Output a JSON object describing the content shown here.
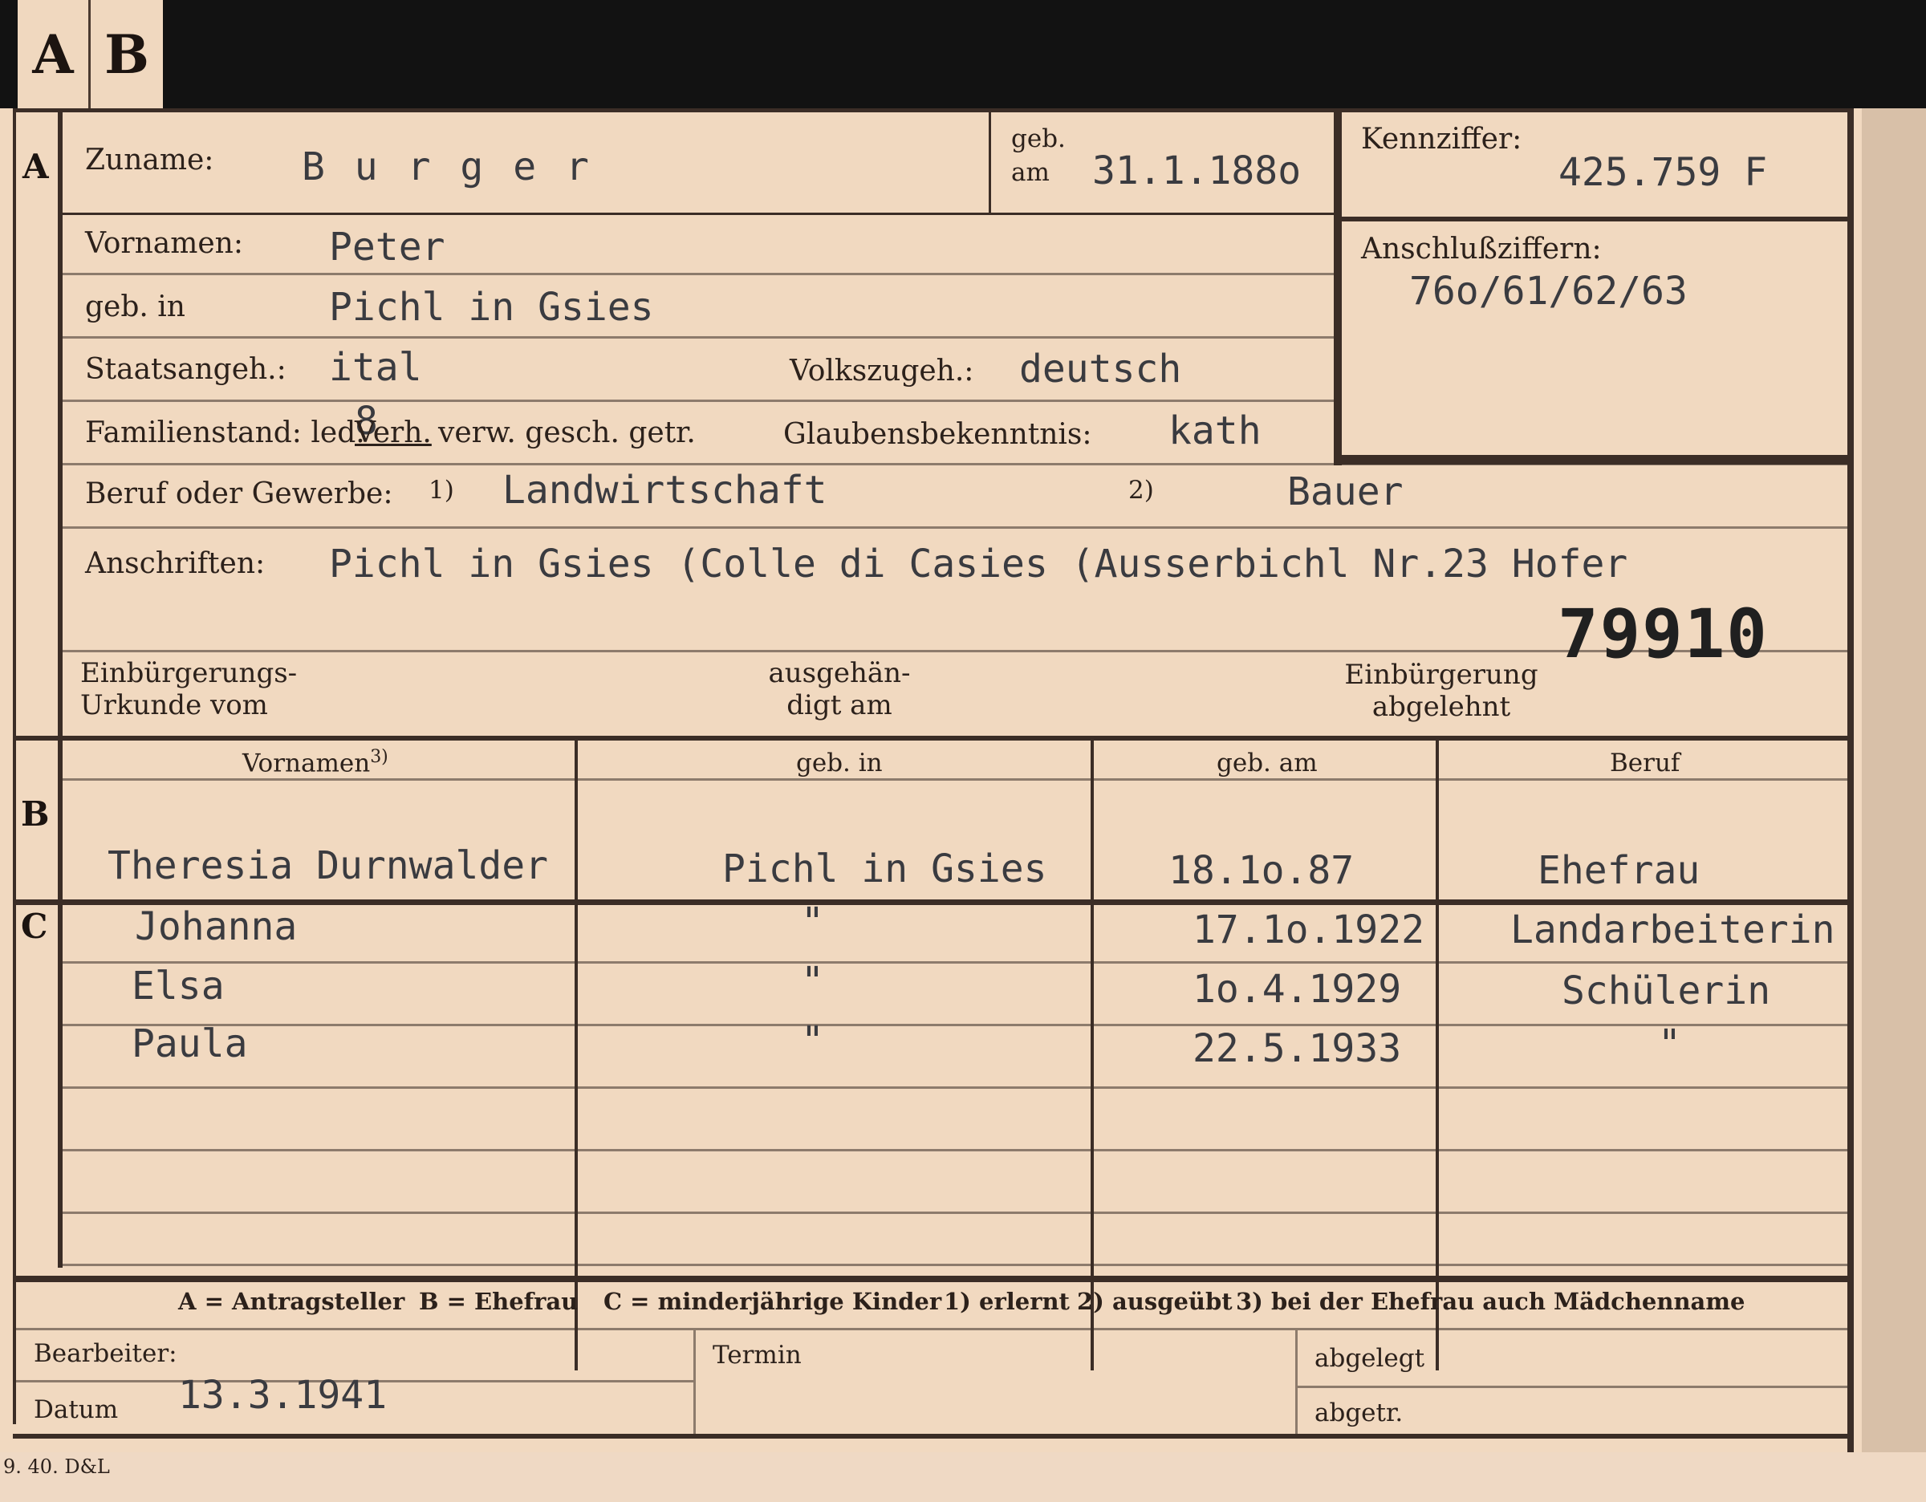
{
  "header_tabs": {
    "a": "A",
    "b": "B"
  },
  "sections": {
    "a": "A",
    "b": "B",
    "c": "C"
  },
  "labels": {
    "zuname": "Zuname:",
    "geb": "geb.",
    "am": "am",
    "kennziffer": "Kennziffer:",
    "vornamen": "Vornamen:",
    "anschlussziffern": "Anschlußziffern:",
    "geb_in": "geb. in",
    "staatsangeh": "Staatsangeh.:",
    "volkszugeh": "Volkszugeh.:",
    "familienstand": "Familienstand: led.",
    "familienstand_options": "verw. gesch. getr.",
    "verh": "Verh.",
    "glaubensbekenntnis": "Glaubensbekenntnis:",
    "beruf_oder_gewerbe": "Beruf oder Gewerbe:",
    "note1": "1)",
    "note2": "2)",
    "anschriften": "Anschriften:",
    "einbuergerung_urkunde": "Einbürgerungs-\nUrkunde vom",
    "ausgehaendigt": "ausgehän-\ndigt am",
    "einbuergerung_abgelehnt": "Einbürgerung\nabgelehnt",
    "bearbeiter": "Bearbeiter:",
    "datum": "Datum",
    "termin": "Termin",
    "abgelegt": "abgelegt",
    "abgetr": "abgetr."
  },
  "applicant": {
    "surname": "B u r g e r",
    "birth_date": "31.1.188o",
    "kennziffer": "425.759 F",
    "first_names": "Peter",
    "anschlussziffern": "76o/61/62/63",
    "birthplace": "Pichl in Gsies",
    "citizenship": "ital",
    "ethnicity": "deutsch",
    "status_mark": "8",
    "religion": "kath",
    "occupation_learned": "Landwirtschaft",
    "occupation_practiced": "Bauer",
    "address": "Pichl in Gsies (Colle di Casies (Ausserbichl Nr.23 Hofer",
    "stamp_number": "79910"
  },
  "family_table": {
    "headers": [
      "Vornamen",
      "geb. in",
      "geb. am",
      "Beruf"
    ],
    "header_note": "3)",
    "spouse": {
      "name": "Theresia Durnwalder",
      "birthplace": "Pichl in Gsies",
      "birth_date": "18.1o.87",
      "occupation": "Ehefrau"
    },
    "children": [
      {
        "name": "Johanna",
        "birthplace": "\"",
        "birth_date": "17.1o.1922",
        "occupation": "Landarbeiterin"
      },
      {
        "name": "Elsa",
        "birthplace": "\"",
        "birth_date": "1o.4.1929",
        "occupation": "Schülerin"
      },
      {
        "name": "Paula",
        "birthplace": "\"",
        "birth_date": "22.5.1933",
        "occupation": "\""
      }
    ]
  },
  "legend": {
    "a": "A = Antragsteller",
    "b": "B = Ehefrau",
    "c": "C = minderjährige Kinder",
    "n1": "1) erlernt",
    "n2": "2) ausgeübt",
    "n3": "3) bei der Ehefrau auch Mädchenname"
  },
  "processing": {
    "datum": "13.3.1941"
  },
  "footer_imprint": "9. 40. D&L"
}
